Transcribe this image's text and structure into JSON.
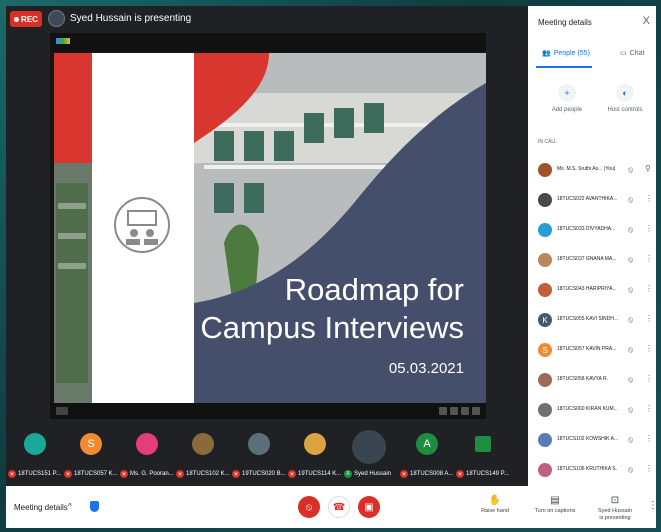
{
  "top": {
    "rec_label": "REC",
    "presenting_text": "Syed Hussain is presenting"
  },
  "slide": {
    "title_line1": "Roadmap for",
    "title_line2": "Campus Interviews",
    "date": "05.03.2021"
  },
  "strip": [
    {
      "name": "18TUCS151 P...",
      "avatar_color": "#1aa89a",
      "initial": ""
    },
    {
      "name": "18TUCS057 K...",
      "avatar_color": "#f28b30",
      "initial": "S"
    },
    {
      "name": "Ms. G. Pooran...",
      "avatar_color": "#e53c7a",
      "initial": ""
    },
    {
      "name": "18TUCS102 K...",
      "avatar_color": "#8a6a3a",
      "initial": ""
    },
    {
      "name": "19TUCS020 B...",
      "avatar_color": "#5b6f7a",
      "initial": ""
    },
    {
      "name": "19TUCS114 K...",
      "avatar_color": "#d9a441",
      "initial": ""
    },
    {
      "name": "Syed Hussain",
      "avatar_color": "#3a4552",
      "initial": ""
    },
    {
      "name": "18TUCS008 A...",
      "avatar_color": "#1e8e3e",
      "initial": "A"
    },
    {
      "name": "18TUCS149 P...",
      "avatar_color": "#1e8e3e",
      "initial": ""
    }
  ],
  "panel": {
    "title": "Meeting details",
    "close": "X",
    "tab_people": "People (55)",
    "tab_chat": "Chat",
    "add_people": "Add people",
    "host_controls": "Host controls",
    "in_call": "IN CALL",
    "people": [
      {
        "name": "Ms. M.S. Sruthi As...  (You)",
        "color": "#a0522d",
        "initial": ""
      },
      {
        "name": "18TUCS022 AVANTHIKA...",
        "color": "#4a4a4a",
        "initial": ""
      },
      {
        "name": "18TUCS033 DIVYADHA...",
        "color": "#2a9dd8",
        "initial": ""
      },
      {
        "name": "18TUCS037 GNANA MA...",
        "color": "#b8895a",
        "initial": ""
      },
      {
        "name": "18TUCS043 HARIPRIYA...",
        "color": "#c0603a",
        "initial": ""
      },
      {
        "name": "18TUCS055 KAVI SINDH...",
        "color": "#455a64",
        "initial": "K"
      },
      {
        "name": "18TUCS057 KAVIN PRA...",
        "color": "#f28b30",
        "initial": "S"
      },
      {
        "name": "18TUCS058 KAVYA R.",
        "color": "#9c6b5a",
        "initial": ""
      },
      {
        "name": "18TUCS060 KIRAN KUM...",
        "color": "#707070",
        "initial": ""
      },
      {
        "name": "18TUCS102 KOWSHIK A...",
        "color": "#5a7ab8",
        "initial": ""
      },
      {
        "name": "18TUCS106 KRUTHIKA S.",
        "color": "#c06080",
        "initial": ""
      }
    ]
  },
  "bottom": {
    "meeting_details": "Meeting details",
    "raise_hand": "Raise hand",
    "captions": "Turn on captions",
    "presenting_line1": "Syed Hussain",
    "presenting_line2": "is presenting"
  }
}
